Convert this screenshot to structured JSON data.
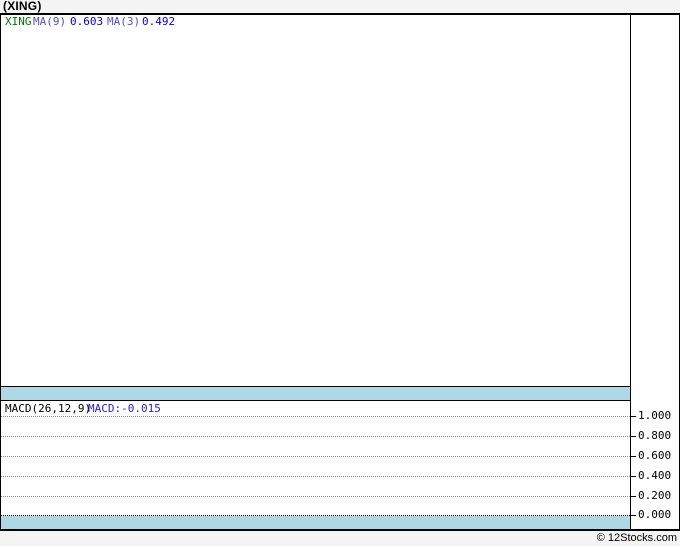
{
  "page": {
    "title": "(XING)",
    "footer_credit": "© 12Stocks.com",
    "colors": {
      "page_bg": "#f4f4f4",
      "pane_bg": "#ffffff",
      "divider_band": "#add8e6",
      "border": "#000000",
      "gridline": "#8a8a8a",
      "symbol_green": "#007700",
      "ma_label_violet": "#5050cc",
      "value_blue": "#0000dd",
      "macd_value_blue": "#2222dd"
    }
  },
  "main_pane": {
    "legend": {
      "symbol": "XING",
      "ma9_label": "MA(9)",
      "ma9_value": "0.603",
      "ma3_label": "MA(3)",
      "ma3_value": "0.492"
    }
  },
  "macd_pane": {
    "legend": {
      "label": "MACD(26,12,9)",
      "value": "MACD:-0.015"
    },
    "axis_ticks": [
      "1.000",
      "0.800",
      "0.600",
      "0.400",
      "0.200",
      "0.000"
    ]
  },
  "chart_data": [
    {
      "type": "line",
      "title": "(XING) price with moving averages",
      "series": [
        {
          "name": "XING",
          "values": []
        },
        {
          "name": "MA(9)",
          "values": [],
          "latest": 0.603
        },
        {
          "name": "MA(3)",
          "values": [],
          "latest": 0.492
        }
      ],
      "legend_position": "top-left",
      "note": "plot area is empty in screenshot"
    },
    {
      "type": "line",
      "title": "MACD(26,12,9)",
      "series": [
        {
          "name": "MACD",
          "values": [],
          "latest": -0.015
        }
      ],
      "ylim": [
        0.0,
        1.0
      ],
      "yticks": [
        1.0,
        0.8,
        0.6,
        0.4,
        0.2,
        0.0
      ],
      "grid": true,
      "legend_position": "top-left"
    }
  ]
}
